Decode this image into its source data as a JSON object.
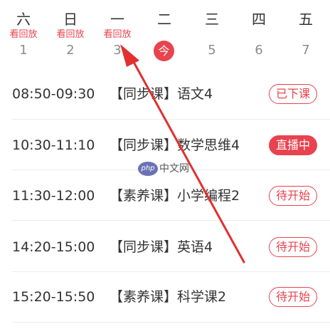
{
  "week": {
    "days": [
      {
        "name": "六",
        "replay": "看回放",
        "date": "1"
      },
      {
        "name": "日",
        "replay": "看回放",
        "date": "2"
      },
      {
        "name": "一",
        "replay": "看回放",
        "date": "3"
      },
      {
        "name": "二",
        "replay": "",
        "date": "今"
      },
      {
        "name": "三",
        "replay": "",
        "date": "5"
      },
      {
        "name": "四",
        "replay": "",
        "date": "6"
      },
      {
        "name": "五",
        "replay": "",
        "date": "7"
      }
    ]
  },
  "schedule": [
    {
      "time": "08:50-09:30",
      "title": "【同步课】语文4",
      "status": "已下课"
    },
    {
      "time": "10:30-11:10",
      "title": "【同步课】数学思维4",
      "status": "直播中"
    },
    {
      "time": "11:30-12:00",
      "title": "【素养课】小学编程2",
      "status": "待开始"
    },
    {
      "time": "14:20-15:00",
      "title": "【同步课】英语4",
      "status": "待开始"
    },
    {
      "time": "15:20-15:50",
      "title": "【素养课】科学课2",
      "status": "待开始"
    }
  ],
  "watermark": {
    "logo": "php",
    "text": "中文网"
  },
  "colors": {
    "accent": "#e8434f",
    "text": "#333333",
    "muted": "#8c8c8c",
    "divider": "#ececec"
  },
  "icons": {
    "annotation": "red-arrow-icon"
  }
}
